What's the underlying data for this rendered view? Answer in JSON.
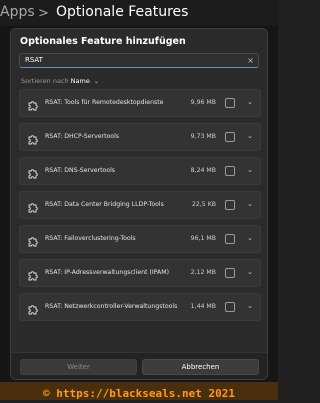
{
  "header": {
    "breadcrumb_apps": "Apps",
    "breadcrumb_separator": ">",
    "page_title": "Optionale Features"
  },
  "dialog": {
    "title": "Optionales Feature hinzufügen",
    "search": {
      "value": "RSAT",
      "clear_icon": "×"
    },
    "sort": {
      "label": "Sortieren nach",
      "value": "Name",
      "chevron": "⌄"
    },
    "features": [
      {
        "name": "RSAT: Tools für Remotedesktopdienste",
        "size": "9,96 MB"
      },
      {
        "name": "RSAT: DHCP-Servertools",
        "size": "9,73 MB"
      },
      {
        "name": "RSAT: DNS-Servertools",
        "size": "8,24 MB"
      },
      {
        "name": "RSAT: Data Center Bridging LLDP-Tools",
        "size": "22,5 KB"
      },
      {
        "name": "RSAT: Failoverclustering-Tools",
        "size": "96,1 MB"
      },
      {
        "name": "RSAT: IP-Adressverwaltungsclient (IPAM)",
        "size": "2,12 MB"
      },
      {
        "name": "RSAT: Netzwerkcontroller-Verwaltungstools",
        "size": "1,44 MB"
      }
    ],
    "buttons": {
      "next": "Weiter",
      "cancel": "Abbrechen"
    }
  },
  "watermark": "© https://blackseals.net 2021",
  "icons": {
    "feature": "puzzle-icon",
    "expand": "chevron-down-icon",
    "clear": "close-icon"
  },
  "colors": {
    "accent": "#6b8fd6",
    "watermark": "#ff9a1a"
  }
}
